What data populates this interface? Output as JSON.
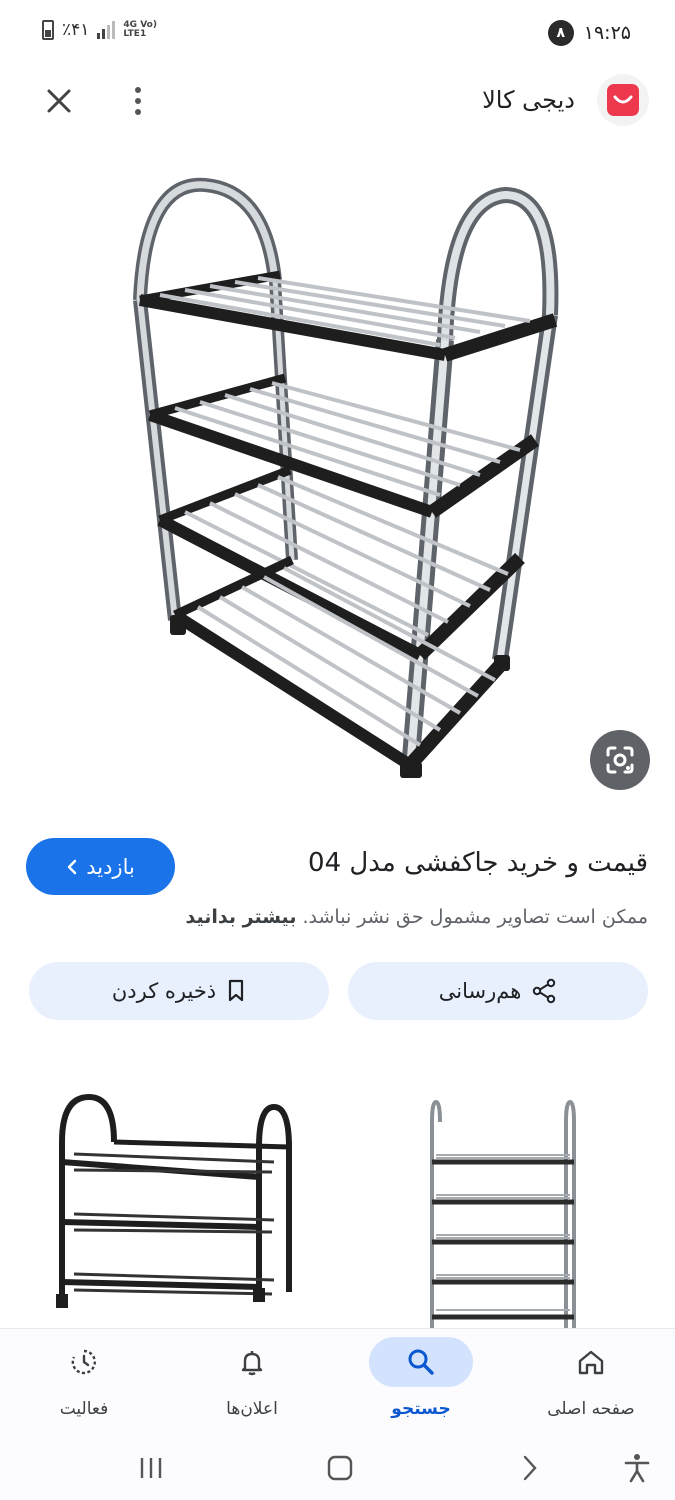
{
  "status_bar": {
    "time": "۱۹:۲۵",
    "notification_count": "۸",
    "battery": "٪۴۱",
    "network_top": "4G Vo)",
    "network_bottom": "LTE1"
  },
  "header": {
    "site_name": "دیجی کالا",
    "brand_color": "#ee384e"
  },
  "result": {
    "title": "قیمت و خرید جاکفشی مدل 04",
    "visit_label": "بازدید",
    "disclaimer": "ممکن است تصاویر مشمول حق نشر نباشد.",
    "learn_more": "بیشتر بدانید"
  },
  "actions": {
    "share_label": "هم‌رسانی",
    "save_label": "ذخیره کردن"
  },
  "bottom_nav": {
    "items": [
      {
        "label": "صفحه اصلی",
        "icon": "home-icon",
        "active": false
      },
      {
        "label": "جستجو",
        "icon": "search-icon",
        "active": true
      },
      {
        "label": "اعلان‌ها",
        "icon": "bell-icon",
        "active": false
      },
      {
        "label": "فعالیت",
        "icon": "activity-icon",
        "active": false
      }
    ]
  },
  "colors": {
    "accent": "#1a73e8",
    "chip_bg": "#e8f0fe",
    "nav_active": "#d3e3fd"
  }
}
